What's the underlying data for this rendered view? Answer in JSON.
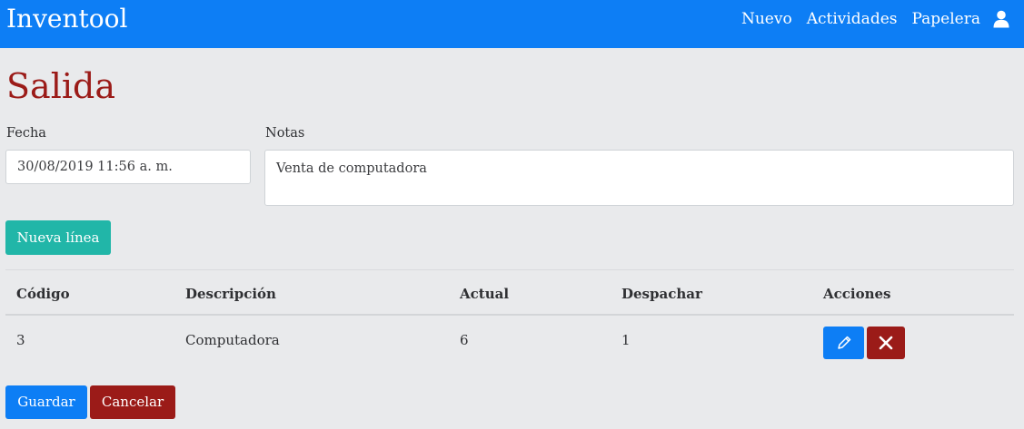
{
  "navbar": {
    "brand": "Inventool",
    "links": [
      "Nuevo",
      "Actividades",
      "Papelera"
    ],
    "user_icon": "user-icon"
  },
  "page": {
    "title": "Salida"
  },
  "form": {
    "fecha_label": "Fecha",
    "fecha_value": "30/08/2019 11:56 a. m.",
    "notas_label": "Notas",
    "notas_value": "Venta de computadora"
  },
  "buttons": {
    "new_line": "Nueva línea",
    "save": "Guardar",
    "cancel": "Cancelar",
    "edit_icon": "pencil-icon",
    "delete_icon": "close-icon"
  },
  "table": {
    "headers": [
      "Código",
      "Descripción",
      "Actual",
      "Despachar",
      "Acciones"
    ],
    "rows": [
      {
        "codigo": "3",
        "descripcion": "Computadora",
        "actual": "6",
        "despachar": "1"
      }
    ]
  },
  "colors": {
    "primary": "#0d7ef5",
    "danger": "#9b1b18",
    "teal": "#21b6a8",
    "background": "#e9eaec"
  }
}
